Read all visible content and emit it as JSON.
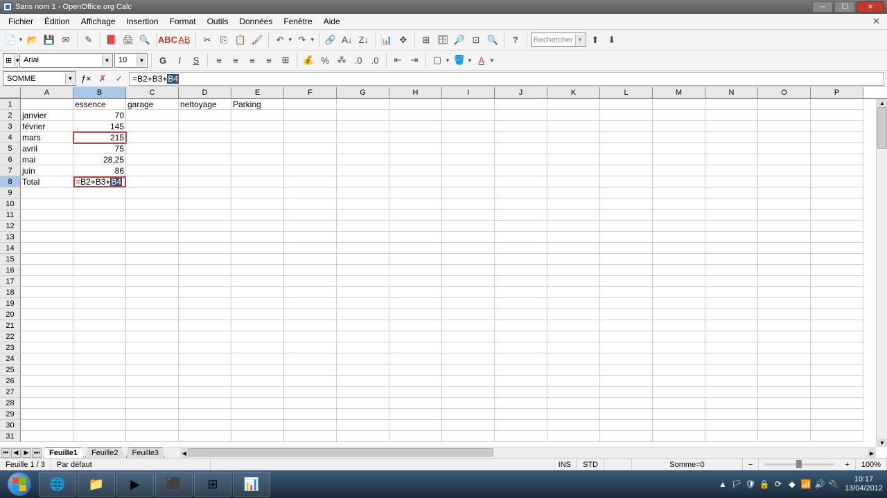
{
  "window": {
    "title": "Sans nom 1 - OpenOffice.org Calc"
  },
  "menubar": [
    "Fichier",
    "Édition",
    "Affichage",
    "Insertion",
    "Format",
    "Outils",
    "Données",
    "Fenêtre",
    "Aide"
  ],
  "search_placeholder": "Rechercher",
  "formatbar": {
    "font": "Arial",
    "size": "10"
  },
  "formula": {
    "namebox": "SOMME",
    "value_prefix": "=B2+B3+",
    "value_hl": "B4"
  },
  "columns": [
    "A",
    "B",
    "C",
    "D",
    "E",
    "F",
    "G",
    "H",
    "I",
    "J",
    "K",
    "L",
    "M",
    "N",
    "O",
    "P"
  ],
  "rows": [
    {
      "n": 1,
      "cells": [
        "",
        "essence",
        "garage",
        "nettoyage",
        "Parking",
        "",
        "",
        "",
        "",
        "",
        "",
        "",
        "",
        "",
        "",
        ""
      ]
    },
    {
      "n": 2,
      "cells": [
        "janvier",
        "70",
        "",
        "",
        "",
        "",
        "",
        "",
        "",
        "",
        "",
        "",
        "",
        "",
        "",
        ""
      ],
      "num": [
        1
      ]
    },
    {
      "n": 3,
      "cells": [
        "février",
        "145",
        "",
        "",
        "",
        "",
        "",
        "",
        "",
        "",
        "",
        "",
        "",
        "",
        "",
        ""
      ],
      "num": [
        1
      ]
    },
    {
      "n": 4,
      "cells": [
        "mars",
        "215",
        "",
        "",
        "",
        "",
        "",
        "",
        "",
        "",
        "",
        "",
        "",
        "",
        "",
        ""
      ],
      "num": [
        1
      ]
    },
    {
      "n": 5,
      "cells": [
        "avril",
        "75",
        "",
        "",
        "",
        "",
        "",
        "",
        "",
        "",
        "",
        "",
        "",
        "",
        "",
        ""
      ],
      "num": [
        1
      ]
    },
    {
      "n": 6,
      "cells": [
        "mai",
        "28,25",
        "",
        "",
        "",
        "",
        "",
        "",
        "",
        "",
        "",
        "",
        "",
        "",
        "",
        ""
      ],
      "num": [
        1
      ]
    },
    {
      "n": 7,
      "cells": [
        "juin",
        "86",
        "",
        "",
        "",
        "",
        "",
        "",
        "",
        "",
        "",
        "",
        "",
        "",
        "",
        ""
      ],
      "num": [
        1
      ]
    },
    {
      "n": 8,
      "cells": [
        "Total",
        "",
        "",
        "",
        "",
        "",
        "",
        "",
        "",
        "",
        "",
        "",
        "",
        "",
        "",
        ""
      ]
    },
    {
      "n": 9
    },
    {
      "n": 10
    },
    {
      "n": 11
    },
    {
      "n": 12
    },
    {
      "n": 13
    },
    {
      "n": 14
    },
    {
      "n": 15
    },
    {
      "n": 16
    },
    {
      "n": 17
    },
    {
      "n": 18
    },
    {
      "n": 19
    },
    {
      "n": 20
    },
    {
      "n": 21
    },
    {
      "n": 22
    },
    {
      "n": 23
    },
    {
      "n": 24
    },
    {
      "n": 25
    },
    {
      "n": 26
    },
    {
      "n": 27
    },
    {
      "n": 28
    },
    {
      "n": 29
    },
    {
      "n": 30
    },
    {
      "n": 31
    }
  ],
  "editing_cell": {
    "row": 8,
    "col": 1,
    "prefix": "=B2+B3+",
    "hl": "B4"
  },
  "ref_cell": {
    "row": 4,
    "col": 1
  },
  "selected_col": 1,
  "selected_row": 8,
  "sheet_tabs": [
    "Feuille1",
    "Feuille2",
    "Feuille3"
  ],
  "active_sheet": 0,
  "status": {
    "sheet": "Feuille 1 / 3",
    "style": "Par défaut",
    "ins": "INS",
    "std": "STD",
    "sum": "Somme=0",
    "zoom": "100%"
  },
  "taskbar": {
    "time": "10:17",
    "date": "13/04/2012"
  }
}
